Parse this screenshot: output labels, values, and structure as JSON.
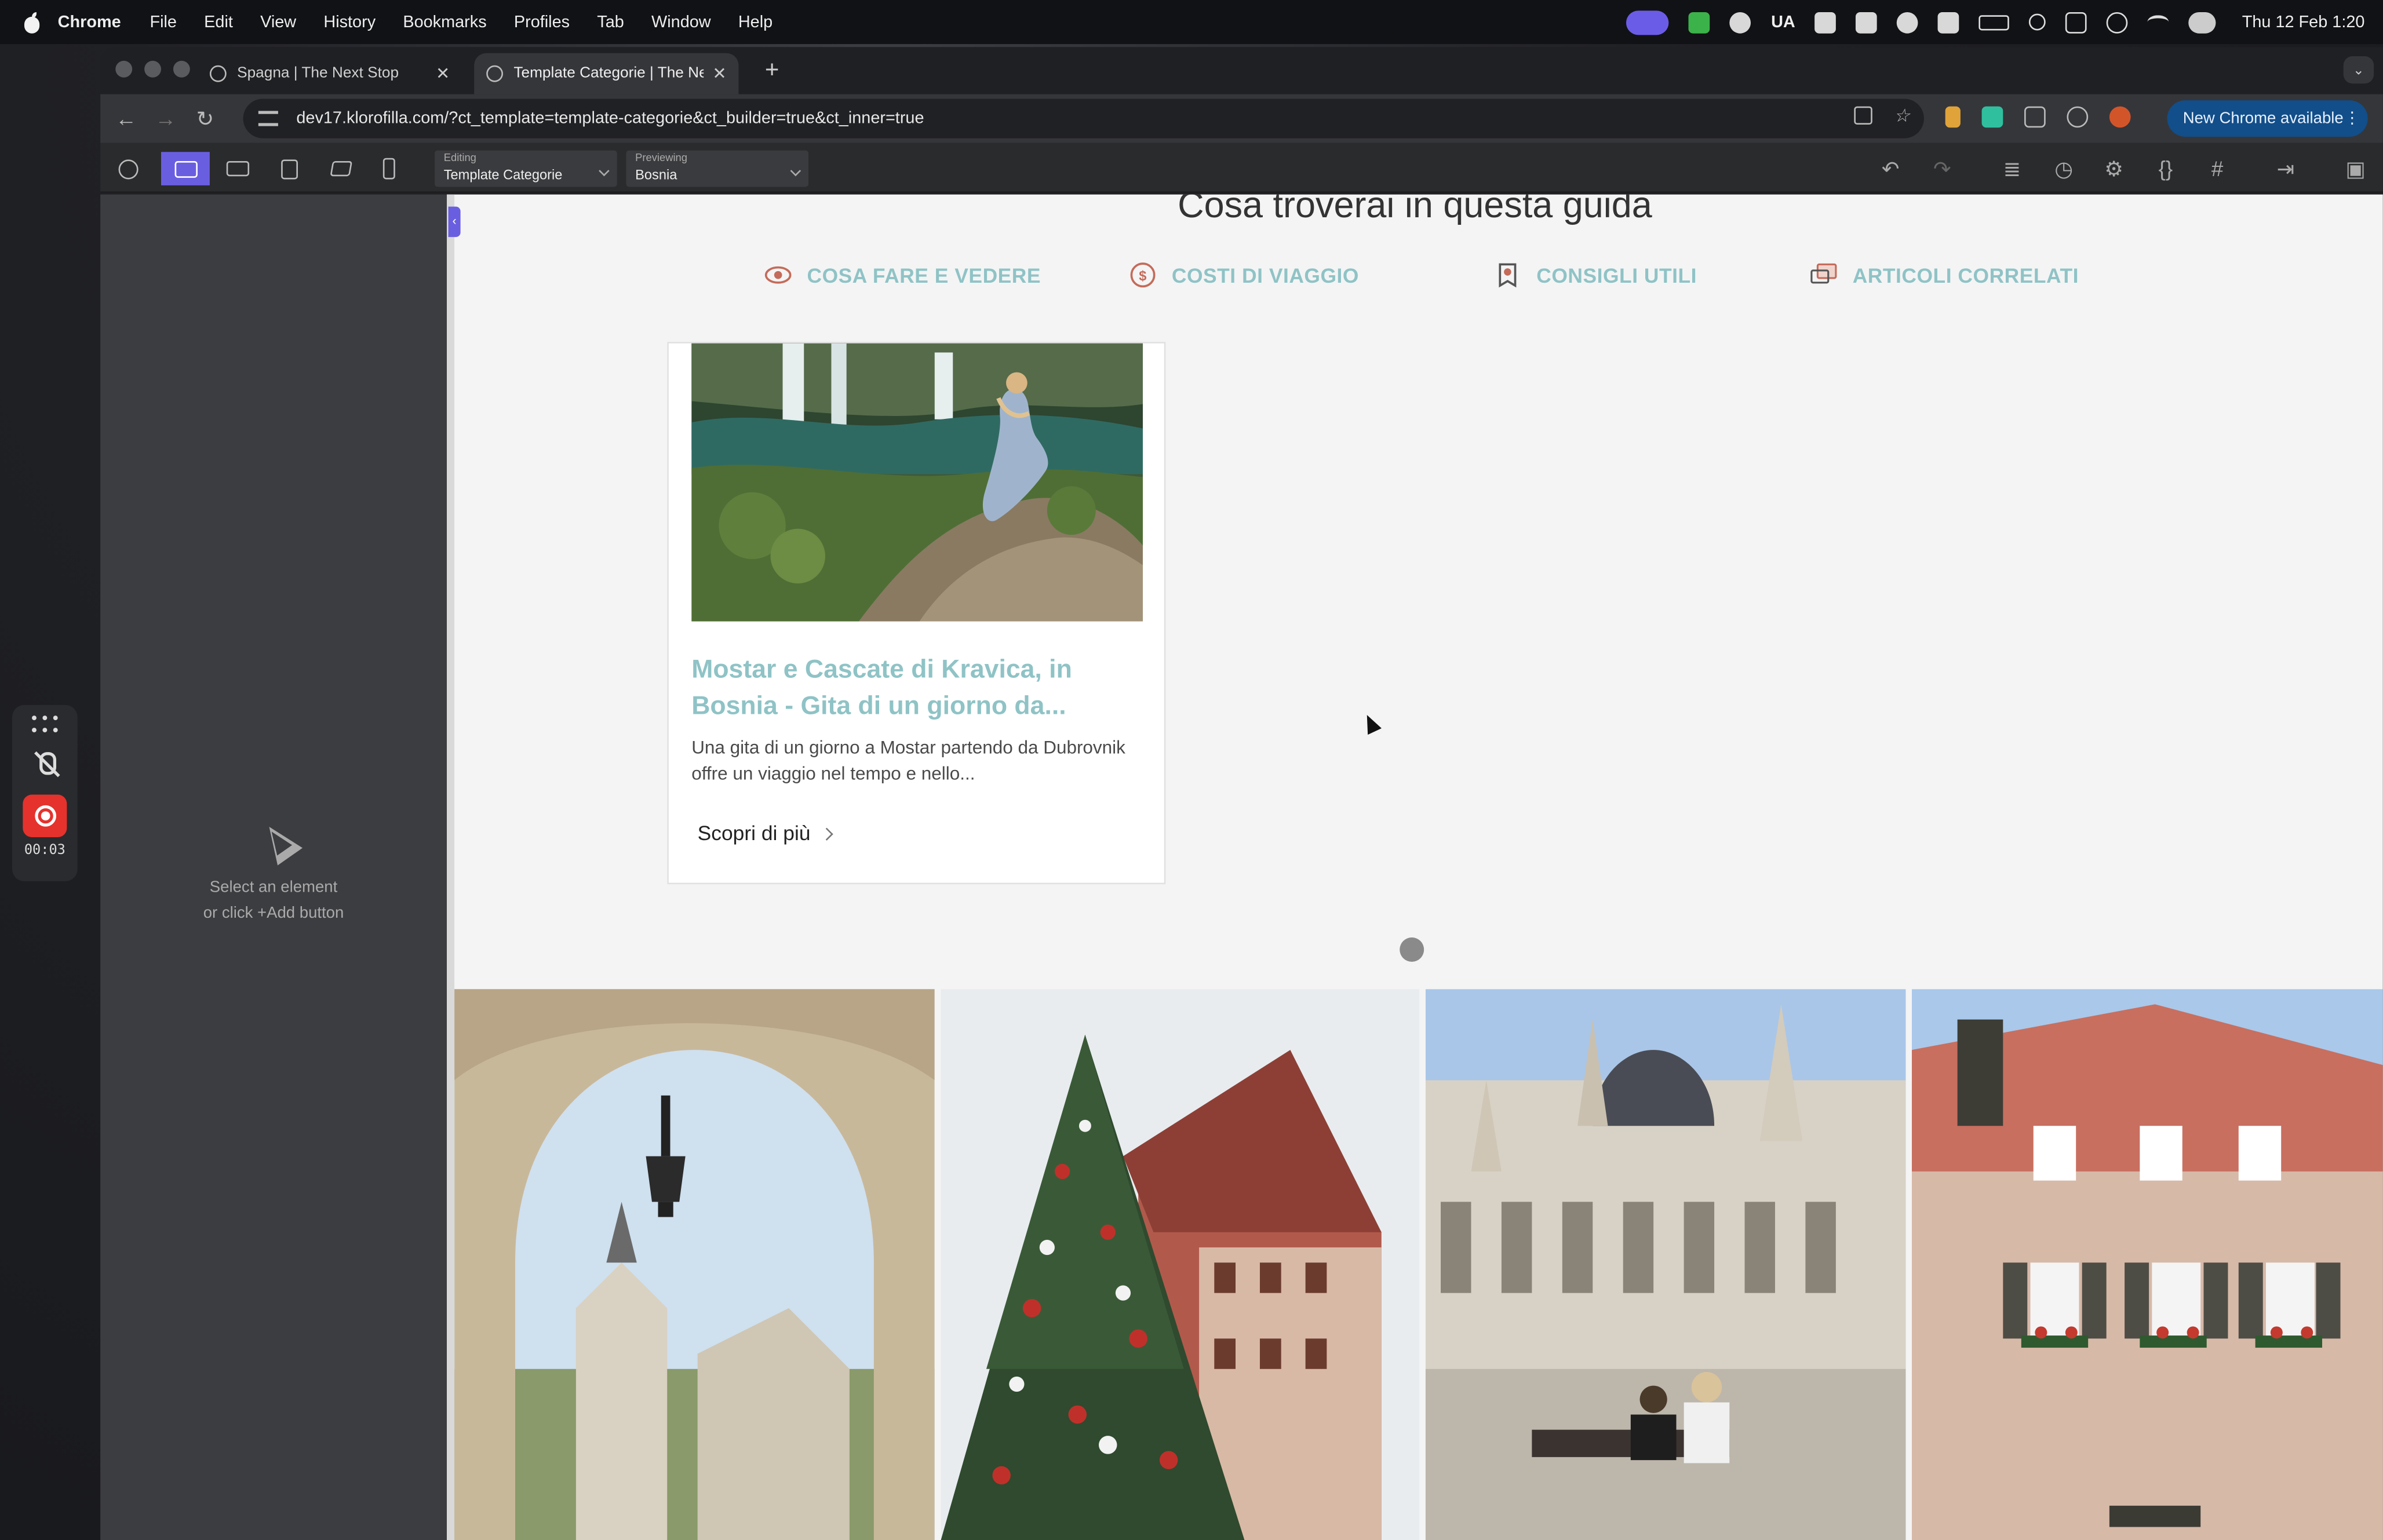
{
  "menubar": {
    "app": "Chrome",
    "items": [
      "File",
      "Edit",
      "View",
      "History",
      "Bookmarks",
      "Profiles",
      "Tab",
      "Window",
      "Help"
    ],
    "tray_text": "UA",
    "clock": "Thu 12 Feb  1:20"
  },
  "recorder": {
    "time": "00:03"
  },
  "tabs": [
    {
      "title": "Spagna | The Next Stop"
    },
    {
      "title": "Template Categorie | The Next Stop"
    }
  ],
  "omnibox": {
    "url": "dev17.klorofilla.com/?ct_template=template-categorie&ct_builder=true&ct_inner=true"
  },
  "update_button": "New Chrome available",
  "builder": {
    "editing_label": "Editing",
    "editing_value": "Template Categorie",
    "previewing_label": "Previewing",
    "previewing_value": "Bosnia"
  },
  "left_panel": {
    "hint_line1": "Select an element",
    "hint_line2": "or click +Add button"
  },
  "page": {
    "title": "Cosa troverai in questa guida",
    "quicknav": [
      {
        "label": "COSA FARE E VEDERE",
        "icon": "eye-icon"
      },
      {
        "label": "COSTI DI VIAGGIO",
        "icon": "coin-icon"
      },
      {
        "label": "CONSIGLI UTILI",
        "icon": "bookmark-icon"
      },
      {
        "label": "ARTICOLI CORRELATI",
        "icon": "chat-icon"
      }
    ],
    "card": {
      "title": "Mostar e Cascate di Kravica, in Bosnia - Gita di un giorno da...",
      "excerpt": "Una gita di un giorno a Mostar partendo da Dubrovnik offre un viaggio nel tempo e nello...",
      "cta": "Scopri di più"
    }
  },
  "colors": {
    "accent_builder": "#6a5ee0",
    "teal_link": "#8fc3c6",
    "chrome_update": "#124e89",
    "record_red": "#e5322d"
  }
}
